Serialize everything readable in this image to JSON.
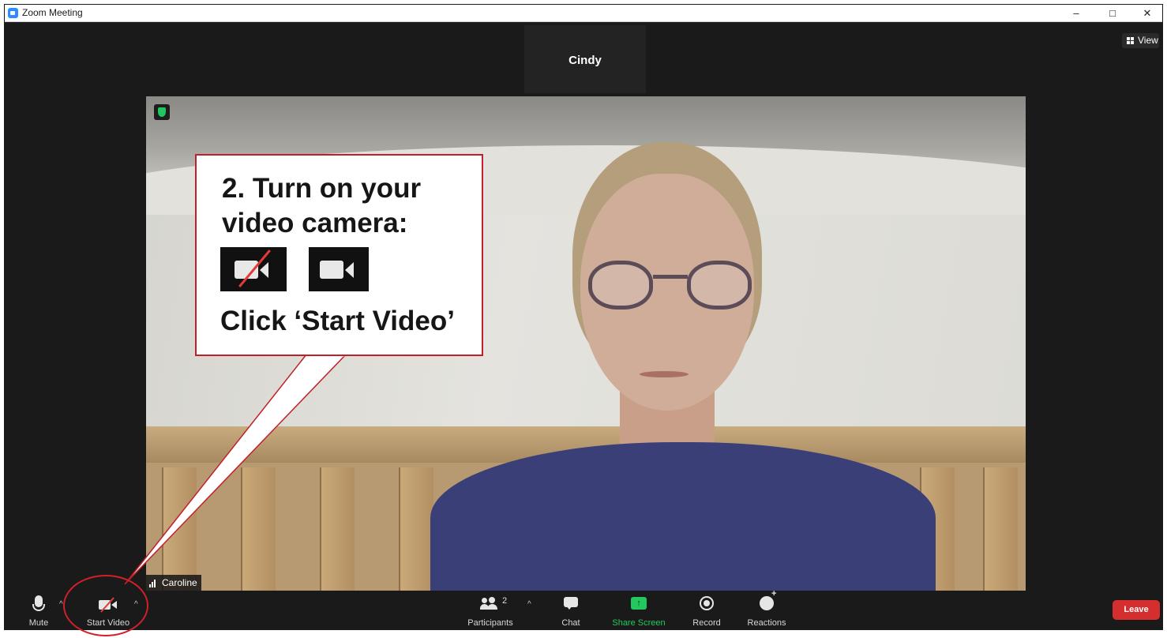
{
  "window": {
    "title": "Zoom Meeting",
    "controls": [
      "–",
      "□",
      "✕"
    ]
  },
  "gallery": {
    "thumbnail_name": "Cindy",
    "view_label": "View"
  },
  "main_video": {
    "participant_name": "Caroline"
  },
  "callout": {
    "step_text": "2. Turn on your video camera:",
    "action_text": "Click ‘Start Video’"
  },
  "toolbar": {
    "mute_label": "Mute",
    "start_video_label": "Start Video",
    "participants_label": "Participants",
    "participants_count": "2",
    "chat_label": "Chat",
    "share_screen_label": "Share Screen",
    "record_label": "Record",
    "reactions_label": "Reactions",
    "leave_label": "Leave",
    "caret": "^"
  },
  "colors": {
    "share_green": "#23c95f",
    "leave_red": "#d42e2e",
    "callout_border": "#c0202a",
    "encryption_shield": "#22c55e"
  },
  "icons": [
    "zoom-app-icon",
    "view-grid-icon",
    "shield-icon",
    "signal-icon",
    "microphone-icon",
    "video-off-icon",
    "video-on-icon",
    "participants-icon",
    "chat-icon",
    "share-screen-icon",
    "record-icon",
    "reactions-icon"
  ]
}
